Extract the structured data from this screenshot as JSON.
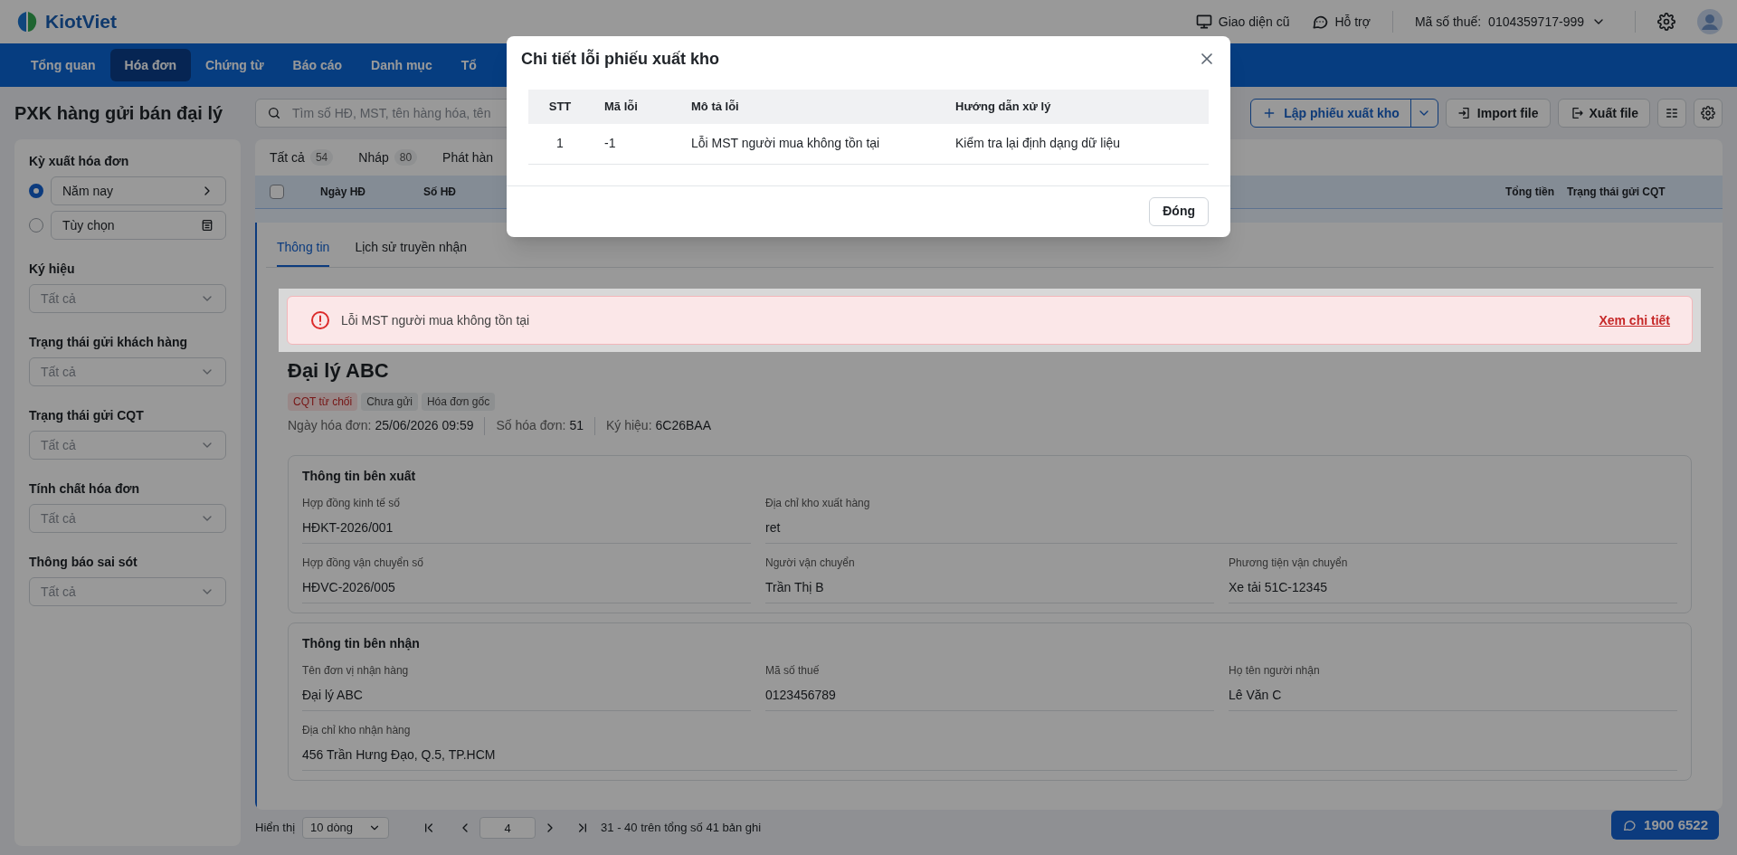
{
  "header": {
    "logo_text": "KiotViet",
    "links": [
      {
        "kind": "monitor",
        "label": "Giao diện cũ"
      },
      {
        "kind": "chat",
        "label": "Hỗ trợ"
      }
    ],
    "tax_label": "Mã số thuế:",
    "tax_value": "0104359717-999"
  },
  "nav": [
    {
      "label": "Tổng quan",
      "selected": false
    },
    {
      "label": "Hóa đơn",
      "selected": true
    },
    {
      "label": "Chứng từ",
      "selected": false
    },
    {
      "label": "Báo cáo",
      "selected": false
    },
    {
      "label": "Danh mục",
      "selected": false
    },
    {
      "label": "Tổ",
      "selected": false
    }
  ],
  "page_title": "PXK hàng gửi bán đại lý",
  "search": {
    "placeholder": "Tìm số HĐ, MST, tên hàng hóa, tên"
  },
  "toolbar": [
    {
      "kind": "primary",
      "label": "Lập phiếu xuất kho"
    },
    {
      "kind": "import",
      "label": "Import file"
    },
    {
      "kind": "export",
      "label": "Xuất file"
    },
    {
      "kind": "columns"
    },
    {
      "kind": "settings"
    }
  ],
  "sidebar": {
    "filters": [
      {
        "kind": "radio",
        "label": "Kỳ xuất hóa đơn",
        "options": [
          {
            "kind": "preset",
            "label": "Năm nay",
            "selected": true
          },
          {
            "kind": "custom",
            "label": "Tùy chọn",
            "selected": false
          }
        ]
      },
      {
        "kind": "select",
        "label": "Ký hiệu",
        "value": "Tất cả"
      },
      {
        "kind": "select",
        "label": "Trạng thái gửi khách hàng",
        "value": "Tất cả"
      },
      {
        "kind": "select",
        "label": "Trạng thái gửi CQT",
        "value": "Tất cả"
      },
      {
        "kind": "select",
        "label": "Tính chất hóa đơn",
        "value": "Tất cả"
      },
      {
        "kind": "select",
        "label": "Thông báo sai sót",
        "value": "Tất cả"
      }
    ]
  },
  "list_tabs": [
    {
      "label": "Tất cả",
      "count": "54",
      "selected": false
    },
    {
      "label": "Nháp",
      "count": "80",
      "selected": false
    },
    {
      "label": "Phát hàn",
      "selected": false
    }
  ],
  "table": {
    "select_all": {
      "checked": false
    },
    "columns": [
      "Ngày HĐ",
      "Số HĐ",
      "Tổng tiền",
      "Trạng thái gửi CQT"
    ]
  },
  "detail": {
    "tabs": [
      {
        "label": "Thông tin",
        "selected": true
      },
      {
        "label": "Lịch sử truyền nhận",
        "selected": false
      }
    ],
    "error_banner": {
      "message": "Lỗi MST người mua không tồn tại",
      "link": "Xem chi tiết"
    },
    "title": "Đại lý ABC",
    "badges": [
      {
        "label": "CQT từ chối",
        "kind": "error"
      },
      {
        "label": "Chưa gửi",
        "kind": "neutral"
      },
      {
        "label": "Hóa đơn gốc",
        "kind": "neutral"
      }
    ],
    "meta": [
      {
        "label": "Ngày hóa đơn:",
        "value": "25/06/2026 09:59"
      },
      {
        "label": "Số hóa đơn:",
        "value": "51"
      },
      {
        "label": "Ký hiệu:",
        "value": "6C26BAA"
      }
    ],
    "sections": [
      {
        "title": "Thông tin bên xuất",
        "fields": [
          {
            "kind": "narrow",
            "label": "Hợp đồng kinh tế số",
            "value": "HĐKT-2026/001"
          },
          {
            "kind": "wide",
            "label": "Địa chỉ kho xuất hàng",
            "value": "ret"
          },
          {
            "kind": "narrow",
            "label": "Hợp đồng vận chuyển số",
            "value": "HĐVC-2026/005"
          },
          {
            "kind": "narrow",
            "label": "Người vận chuyển",
            "value": "Trần Thị B"
          },
          {
            "kind": "narrow",
            "label": "Phương tiện vận chuyển",
            "value": "Xe tải 51C-12345"
          }
        ]
      },
      {
        "title": "Thông tin bên nhận",
        "fields": [
          {
            "kind": "narrow",
            "label": "Tên đơn vị nhận hàng",
            "value": "Đại lý ABC"
          },
          {
            "kind": "narrow",
            "label": "Mã số thuế",
            "value": "0123456789"
          },
          {
            "kind": "narrow",
            "label": "Họ tên người nhận",
            "value": "Lê Văn C"
          },
          {
            "kind": "full",
            "label": "Địa chỉ kho nhận hàng",
            "value": "456 Trần Hưng Đạo, Q.5, TP.HCM"
          }
        ]
      }
    ]
  },
  "pagination": {
    "label": "Hiển thị",
    "page_size": "10 dòng",
    "page": "4",
    "range": "31 - 40 trên tổng số 41 bản ghi"
  },
  "hotline": "1900 6522",
  "modal": {
    "title": "Chi tiết lỗi phiếu xuất kho",
    "columns": [
      "STT",
      "Mã lỗi",
      "Mô tả lỗi",
      "Hướng dẫn xử lý"
    ],
    "rows": [
      [
        "1",
        "-1",
        "Lỗi MST người mua không tồn tại",
        "Kiểm tra lại định dạng dữ liệu"
      ]
    ],
    "close_button": "Đóng"
  }
}
